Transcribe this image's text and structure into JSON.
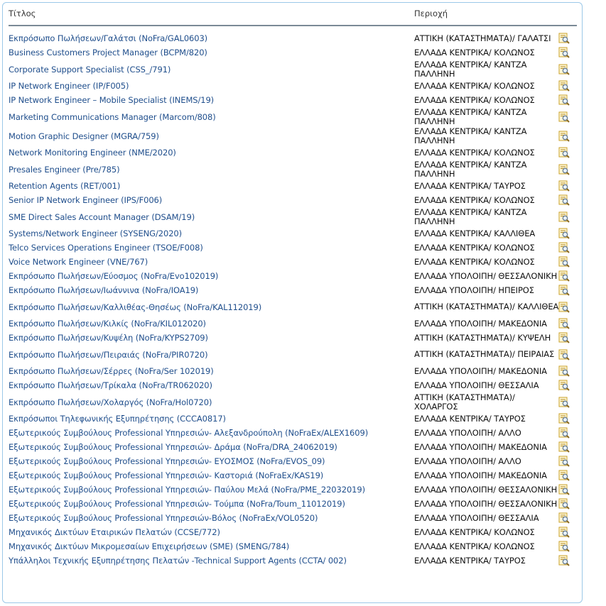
{
  "header": {
    "title_col": "Τίτλος",
    "region_col": "Περιοχή"
  },
  "rows": [
    {
      "title": "Εκπρόσωπο Πωλήσεων/Γαλάτσι (NoFra/GAL0603)",
      "region": "ΑΤΤΙΚΗ (ΚΑΤΑΣΤΗΜΑΤΑ)/ ΓΑΛΑΤΣΙ"
    },
    {
      "title": "Business Customers Project Manager (BCPM/820)",
      "region": "ΕΛΛΑΔΑ ΚΕΝΤΡΙΚΑ/ ΚΟΛΩΝΟΣ"
    },
    {
      "title": "Corporate Support Specialist (CSS_/791)",
      "region": "ΕΛΛΑΔΑ ΚΕΝΤΡΙΚΑ/ ΚΑΝΤΖΑ ΠΑΛΛΗΝΗ"
    },
    {
      "title": "IP Network Engineer (IP/F005)",
      "region": "ΕΛΛΑΔΑ ΚΕΝΤΡΙΚΑ/ ΚΟΛΩΝΟΣ"
    },
    {
      "title": "IP Network Engineer – Mobile Specialist (INEMS/19)",
      "region": "ΕΛΛΑΔΑ ΚΕΝΤΡΙΚΑ/ ΚΟΛΩΝΟΣ"
    },
    {
      "title": "Marketing Communications Manager (Marcom/808)",
      "region": "ΕΛΛΑΔΑ ΚΕΝΤΡΙΚΑ/ ΚΑΝΤΖΑ ΠΑΛΛΗΝΗ"
    },
    {
      "title": "Motion Graphic Designer (MGRA/759)",
      "region": "ΕΛΛΑΔΑ ΚΕΝΤΡΙΚΑ/ ΚΑΝΤΖΑ ΠΑΛΛΗΝΗ"
    },
    {
      "title": "Network Monitoring Engineer (NME/2020)",
      "region": "ΕΛΛΑΔΑ ΚΕΝΤΡΙΚΑ/ ΚΟΛΩΝΟΣ"
    },
    {
      "title": "Presales Engineer (Pre/785)",
      "region": "ΕΛΛΑΔΑ ΚΕΝΤΡΙΚΑ/ ΚΑΝΤΖΑ ΠΑΛΛΗΝΗ"
    },
    {
      "title": "Retention Agents (RET/001)",
      "region": "ΕΛΛΑΔΑ ΚΕΝΤΡΙΚΑ/ ΤΑΥΡΟΣ"
    },
    {
      "title": "Senior IP Network Engineer (IPS/F006)",
      "region": "ΕΛΛΑΔΑ ΚΕΝΤΡΙΚΑ/ ΚΟΛΩΝΟΣ"
    },
    {
      "title": "SME Direct Sales Account Manager (DSAM/19)",
      "region": "ΕΛΛΑΔΑ ΚΕΝΤΡΙΚΑ/ ΚΑΝΤΖΑ ΠΑΛΛΗΝΗ"
    },
    {
      "title": "Systems/Network Engineer (SYSENG/2020)",
      "region": "ΕΛΛΑΔΑ ΚΕΝΤΡΙΚΑ/ ΚΑΛΛΙΘΕΑ"
    },
    {
      "title": "Telco Services Operations Engineer (TSOE/F008)",
      "region": "ΕΛΛΑΔΑ ΚΕΝΤΡΙΚΑ/ ΚΟΛΩΝΟΣ"
    },
    {
      "title": "Voice Network Engineer (VNE/767)",
      "region": "ΕΛΛΑΔΑ ΚΕΝΤΡΙΚΑ/ ΚΟΛΩΝΟΣ"
    },
    {
      "title": "Εκπρόσωπο Πωλήσεων/Εύοσμος (NoFra/Evo102019)",
      "region": "ΕΛΛΑΔΑ ΥΠΟΛΟΙΠΗ/ ΘΕΣΣΑΛΟΝΙΚΗ"
    },
    {
      "title": "Εκπρόσωπο Πωλήσεων/Ιωάννινα (NoFra/IOA19)",
      "region": "ΕΛΛΑΔΑ ΥΠΟΛΟΙΠΗ/ ΗΠΕΙΡΟΣ"
    },
    {
      "title": "Εκπρόσωπο Πωλήσεων/Καλλιθέας-Θησέως (NoFra/KAL112019)",
      "region": "ΑΤΤΙΚΗ (ΚΑΤΑΣΤΗΜΑΤΑ)/ ΚΑΛΛΙΘΕΑ"
    },
    {
      "title": "Εκπρόσωπο Πωλήσεων/Κιλκίς (NoFra/KIL012020)",
      "region": "ΕΛΛΑΔΑ ΥΠΟΛΟΙΠΗ/ ΜΑΚΕΔΟΝΙΑ"
    },
    {
      "title": "Εκπρόσωπο Πωλήσεων/Κυψέλη (NoFra/KYPS2709)",
      "region": "ΑΤΤΙΚΗ (ΚΑΤΑΣΤΗΜΑΤΑ)/ ΚΥΨΕΛΗ"
    },
    {
      "title": "Εκπρόσωπο Πωλήσεων/Πειραιάς (NoFra/PIR0720)",
      "region": "ΑΤΤΙΚΗ (ΚΑΤΑΣΤΗΜΑΤΑ)/ ΠΕΙΡΑΙΑΣ"
    },
    {
      "title": "Εκπρόσωπο Πωλήσεων/Σέρρες (NoFra/Ser 102019)",
      "region": "ΕΛΛΑΔΑ ΥΠΟΛΟΙΠΗ/ ΜΑΚΕΔΟΝΙΑ"
    },
    {
      "title": "Εκπρόσωπο Πωλήσεων/Τρίκαλα (NoFra/TR062020)",
      "region": "ΕΛΛΑΔΑ ΥΠΟΛΟΙΠΗ/ ΘΕΣΣΑΛΙΑ"
    },
    {
      "title": "Εκπρόσωπο Πωλήσεων/Χολαργός (NoFra/Hol0720)",
      "region": "ΑΤΤΙΚΗ (ΚΑΤΑΣΤΗΜΑΤΑ)/ ΧΟΛΑΡΓΟΣ"
    },
    {
      "title": "Εκπρόσωποι Τηλεφωνικής Εξυπηρέτησης (CCCA0817)",
      "region": "ΕΛΛΑΔΑ ΚΕΝΤΡΙΚΑ/ ΤΑΥΡΟΣ"
    },
    {
      "title": "Εξωτερικούς Συμβούλους Professional Υπηρεσιών- Αλεξανδρούπολη (NoFraEx/ALEX1609)",
      "region": "ΕΛΛΑΔΑ ΥΠΟΛΟΙΠΗ/ ΑΛΛΟ"
    },
    {
      "title": "Εξωτερικούς Συμβούλους Professional Υπηρεσιών- Δράμα (NoFra/DRA_24062019)",
      "region": "ΕΛΛΑΔΑ ΥΠΟΛΟΙΠΗ/ ΜΑΚΕΔΟΝΙΑ"
    },
    {
      "title": "Εξωτερικούς Συμβούλους Professional Υπηρεσιών- ΕΥΟΣΜΟΣ (NoFra/EVOS_09)",
      "region": "ΕΛΛΑΔΑ ΥΠΟΛΟΙΠΗ/ ΑΛΛΟ"
    },
    {
      "title": "Εξωτερικούς Συμβούλους Professional Υπηρεσιών- Καστοριά (NoFraEx/KAS19)",
      "region": "ΕΛΛΑΔΑ ΥΠΟΛΟΙΠΗ/ ΜΑΚΕΔΟΝΙΑ"
    },
    {
      "title": "Εξωτερικούς Συμβούλους Professional Υπηρεσιών- Παύλου Μελά (NoFra/PME_22032019)",
      "region": "ΕΛΛΑΔΑ ΥΠΟΛΟΙΠΗ/ ΘΕΣΣΑΛΟΝΙΚΗ"
    },
    {
      "title": "Εξωτερικούς Συμβούλους Professional Υπηρεσιών- Τούμπα (NoFra/Toum_11012019)",
      "region": "ΕΛΛΑΔΑ ΥΠΟΛΟΙΠΗ/ ΘΕΣΣΑΛΟΝΙΚΗ"
    },
    {
      "title": "Εξωτερικούς Συμβούλους Professional Υπηρεσιών-Βόλος (NoFraEx/VOL0520)",
      "region": "ΕΛΛΑΔΑ ΥΠΟΛΟΙΠΗ/ ΘΕΣΣΑΛΙΑ"
    },
    {
      "title": "Μηχανικός Δικτύων Εταιρικών Πελατών (CCSE/772)",
      "region": "ΕΛΛΑΔΑ ΚΕΝΤΡΙΚΑ/ ΚΟΛΩΝΟΣ"
    },
    {
      "title": "Μηχανικός Δικτύων Μικρομεσαίων Επιχειρήσεων (SME) (SMENG/784)",
      "region": "ΕΛΛΑΔΑ ΚΕΝΤΡΙΚΑ/ ΚΟΛΩΝΟΣ"
    },
    {
      "title": "Υπάλληλοι Τεχνικής Εξυπηρέτησης Πελατών -Technical Support Agents (CCTA/ 002)",
      "region": "ΕΛΛΑΔΑ ΚΕΝΤΡΙΚΑ/ ΤΑΥΡΟΣ"
    }
  ],
  "icon": {
    "name": "view-details-icon",
    "color": "#d9a416"
  }
}
